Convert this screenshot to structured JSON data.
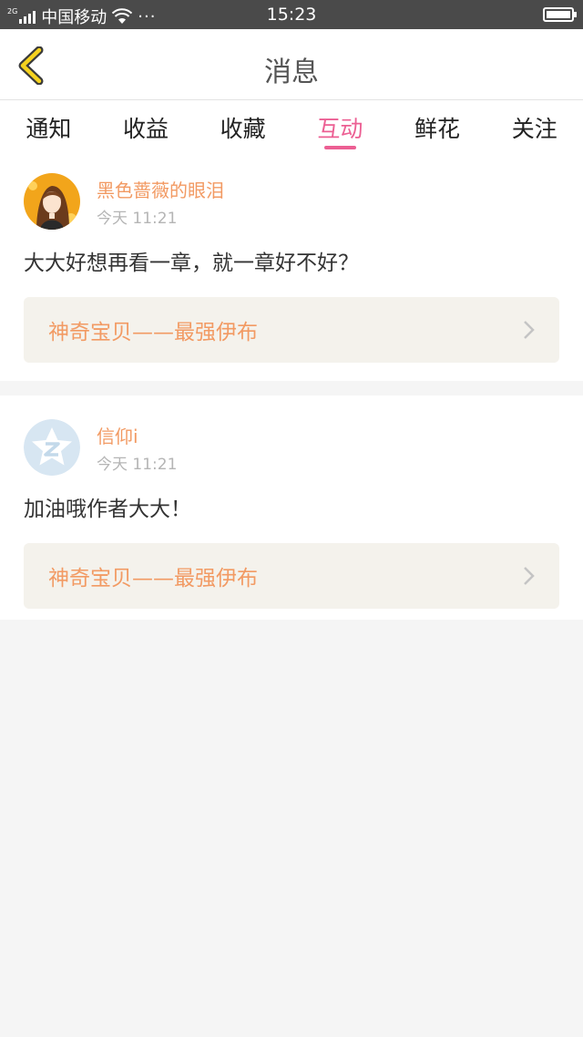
{
  "status_bar": {
    "network": "2G",
    "carrier": "中国移动",
    "more": "···",
    "time": "15:23"
  },
  "header": {
    "title": "消息",
    "back_icon": "chevron-left-icon"
  },
  "tabs": [
    {
      "label": "通知",
      "active": false
    },
    {
      "label": "收益",
      "active": false
    },
    {
      "label": "收藏",
      "active": false
    },
    {
      "label": "互动",
      "active": true
    },
    {
      "label": "鲜花",
      "active": false
    },
    {
      "label": "关注",
      "active": false
    }
  ],
  "messages": [
    {
      "username": "黑色蔷薇的眼泪",
      "time": "今天 11:21",
      "content": "大大好想再看一章，就一章好不好？",
      "book": "神奇宝贝——最强伊布"
    },
    {
      "username": "信仰i",
      "time": "今天 11:21",
      "content": "加油哦作者大大！",
      "book": "神奇宝贝——最强伊布"
    }
  ],
  "colors": {
    "accent": "#ec5f93",
    "name": "#f29a63",
    "book_bg": "#f4f2ec",
    "status_bar": "#4a4a4a"
  }
}
